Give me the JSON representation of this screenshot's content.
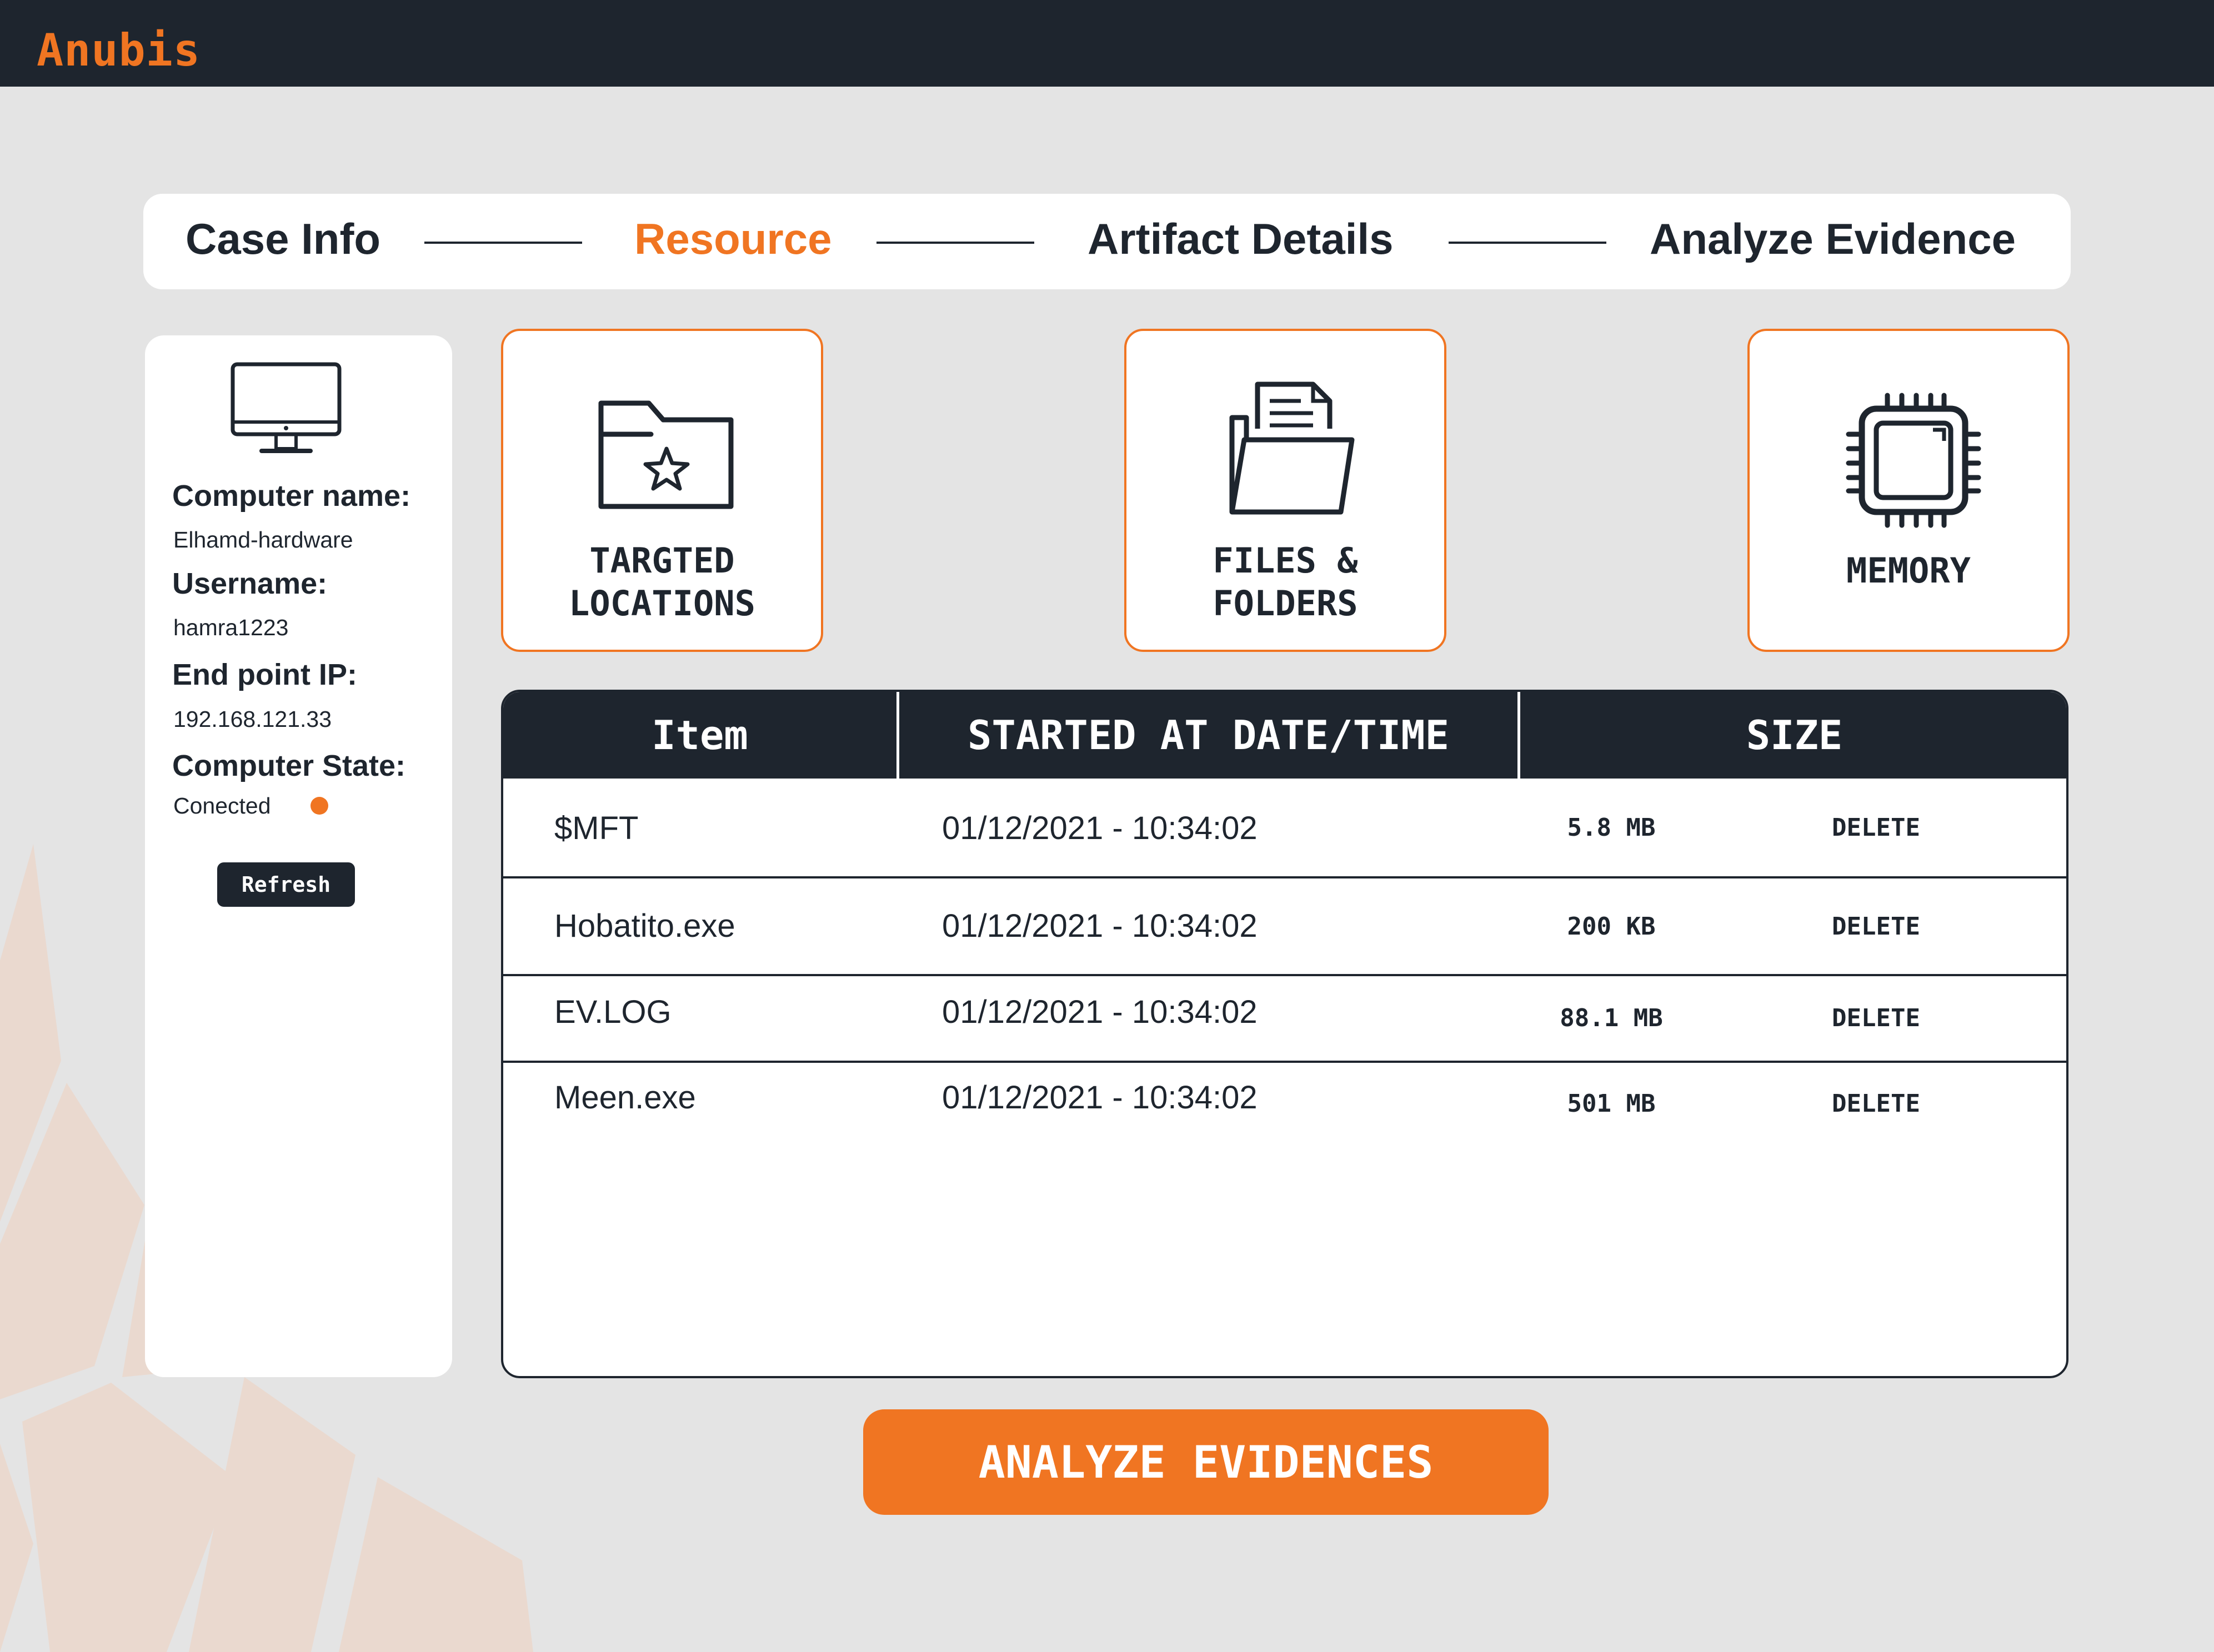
{
  "app": {
    "brand": "Anubis"
  },
  "colors": {
    "accent": "#f07522",
    "dark": "#1e252e",
    "background": "#e4e4e4"
  },
  "stepper": {
    "steps": [
      {
        "label": "Case Info",
        "active": false
      },
      {
        "label": "Resource",
        "active": true
      },
      {
        "label": "Artifact Details",
        "active": false
      },
      {
        "label": "Analyze Evidence",
        "active": false
      }
    ]
  },
  "computer": {
    "icon": "monitor-icon",
    "name_label": "Computer name:",
    "name_value": "Elhamd-hardware",
    "username_label": "Username:",
    "username_value": "hamra1223",
    "ip_label": "End point IP:",
    "ip_value": "192.168.121.33",
    "state_label": "Computer State:",
    "state_value": "Conected",
    "refresh_label": "Refresh"
  },
  "resources": [
    {
      "icon": "folder-star-icon",
      "line1": "TARGTED",
      "line2": "LOCATIONS"
    },
    {
      "icon": "files-folder-icon",
      "line1": "FILES &",
      "line2": "FOLDERS"
    },
    {
      "icon": "memory-chip-icon",
      "line1": "MEMORY"
    }
  ],
  "table": {
    "headers": [
      "Item",
      "STARTED AT DATE/TIME",
      "SIZE"
    ],
    "rows": [
      {
        "item": "$MFT",
        "date": "01/12/2021 - 10:34:02",
        "size": "5.8 MB",
        "action": "DELETE"
      },
      {
        "item": "Hobatito.exe",
        "date": "01/12/2021 - 10:34:02",
        "size": "200 KB",
        "action": "DELETE"
      },
      {
        "item": "EV.LOG",
        "date": "01/12/2021 - 10:34:02",
        "size": "88.1 MB",
        "action": "DELETE"
      },
      {
        "item": "Meen.exe",
        "date": "01/12/2021 - 10:34:02",
        "size": "501 MB",
        "action": "DELETE"
      }
    ]
  },
  "analyze_button": {
    "label": "ANALYZE EVIDENCES"
  }
}
